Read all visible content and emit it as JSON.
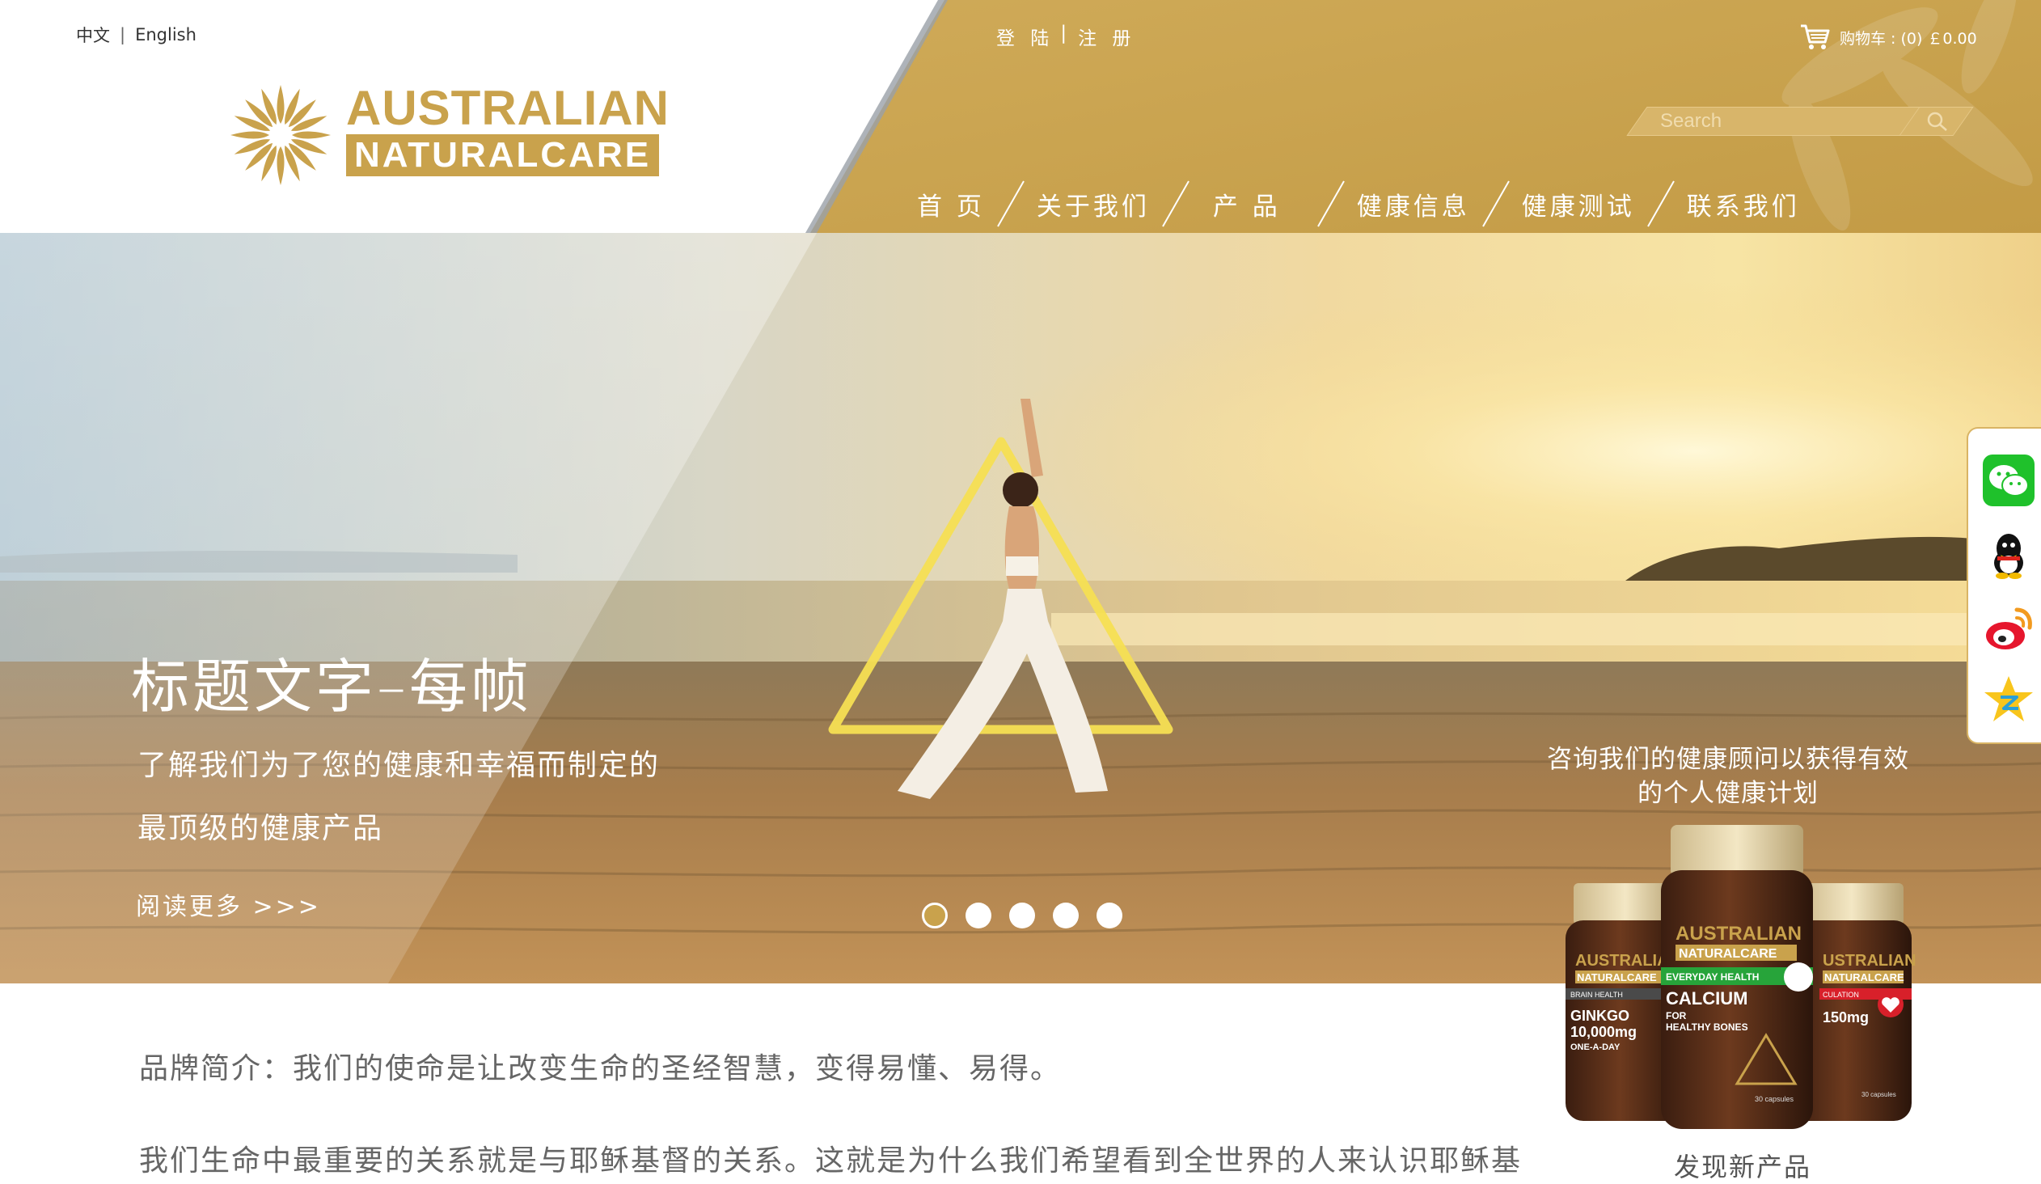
{
  "header": {
    "lang_zh": "中文",
    "lang_sep": "|",
    "lang_en": "English",
    "logo_line1": "AUSTRALIAN",
    "logo_line2": "NATURALCARE",
    "login": "登 陆",
    "login_sep": "|",
    "register": "注 册",
    "cart_label": "购物车 : (0) ￡0.00",
    "search_placeholder": "Search",
    "nav": [
      "首 页",
      "关于我们",
      "产 品",
      "健康信息",
      "健康测试",
      "联系我们"
    ]
  },
  "hero": {
    "title": "标题文字–每帧",
    "desc_line1": "了解我们为了您的健康和幸福而制定的",
    "desc_line2": "最顶级的健康产品",
    "read_more": "阅读更多 >>>",
    "slides": 5,
    "active_slide": 1,
    "consult_line1": "咨询我们的健康顾问以获得有效",
    "consult_line2": "的个人健康计划"
  },
  "products": {
    "left": {
      "brand1": "AUSTRALIAN",
      "brand2": "NATURALCARE",
      "category": "BRAIN HEALTH",
      "name": "GINKGO",
      "dose": "10,000mg",
      "sub": "ONE-A-DAY"
    },
    "center": {
      "brand1": "AUSTRALIAN",
      "brand2": "NATURALCARE",
      "category": "EVERYDAY HEALTH",
      "name": "CALCIUM",
      "sub1": "FOR",
      "sub2": "HEALTHY BONES",
      "count": "30 capsules"
    },
    "right": {
      "brand1": "USTRALIAN",
      "brand2": "NATURALCARE",
      "category": "CULATION",
      "dose": "150mg",
      "count": "30 capsules"
    },
    "caption": "发现新产品"
  },
  "content": {
    "intro": "品牌简介：我们的使命是让改变生命的圣经智慧，变得易懂、易得。",
    "para": "我们生命中最重要的关系就是与耶稣基督的关系。这就是为什么我们希望看到全世界的人来认识耶稣基"
  },
  "colors": {
    "gold": "#c9a24c",
    "gold_light": "#d8b56a",
    "text": "#666666"
  },
  "icons": [
    "cart-icon",
    "search-icon",
    "wechat-icon",
    "qq-icon",
    "weibo-icon",
    "qzone-icon"
  ]
}
